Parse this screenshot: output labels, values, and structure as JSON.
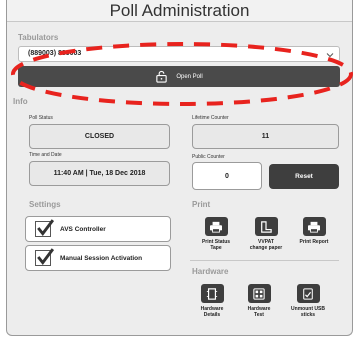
{
  "window": {
    "title": "Poll Administration"
  },
  "tabulators": {
    "label": "Tabulators",
    "selected_value": "(889003) 889003",
    "open_poll_label": "Open Poll"
  },
  "info": {
    "label": "Info",
    "poll_status_label": "Poll Status",
    "poll_status_value": "CLOSED",
    "lifetime_counter_label": "Lifetime Counter",
    "lifetime_counter_value": "11",
    "time_date_label": "Time and Date",
    "time_date_value": "11:40 AM | Tue, 18 Dec 2018",
    "public_counter_label": "Public Counter",
    "public_counter_value": "0",
    "reset_label": "Reset"
  },
  "settings": {
    "label": "Settings",
    "items": [
      {
        "label": "AVS Controller",
        "checked": true
      },
      {
        "label": "Manual Session Activation",
        "checked": true
      }
    ]
  },
  "print": {
    "label": "Print",
    "tools": [
      {
        "line1": "Print Status",
        "line2": "Tape",
        "icon": "printer-icon"
      },
      {
        "line1": "VVPAT",
        "line2": "change paper",
        "icon": "paper-change-icon"
      },
      {
        "line1": "Print Report",
        "line2": "",
        "icon": "printer-icon"
      }
    ]
  },
  "hardware": {
    "label": "Hardware",
    "tools": [
      {
        "line1": "Hardware",
        "line2": "Details",
        "icon": "hardware-details-icon"
      },
      {
        "line1": "Hardware",
        "line2": "Test",
        "icon": "hardware-test-icon"
      },
      {
        "line1": "Unmount USB",
        "line2": "sticks",
        "icon": "usb-unmount-icon"
      }
    ]
  },
  "annotation": {
    "color": "#e8231e"
  },
  "colors": {
    "dark_button": "#3e3e3e",
    "panel": "#ededed"
  }
}
